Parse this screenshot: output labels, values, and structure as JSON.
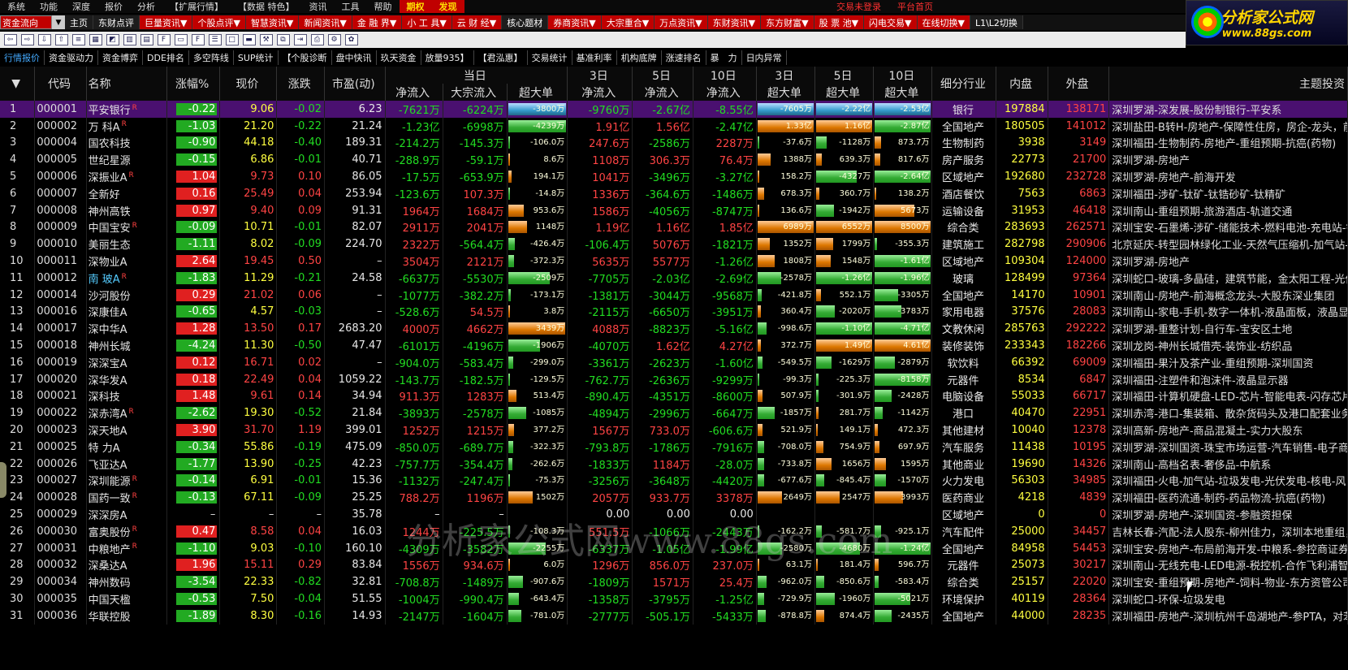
{
  "menu": {
    "items": [
      "系统",
      "功能",
      "深度",
      "报价",
      "分析",
      "【扩展行情】",
      "【数据 特色】",
      "资讯",
      "工具",
      "帮助"
    ],
    "highlights": [
      "期权",
      "发现"
    ],
    "status1": "交易未登录",
    "status2": "平台首页"
  },
  "logo": {
    "text": "分析家公式网",
    "url": "www.88gs.com"
  },
  "nav": {
    "select": "资金流向",
    "items": [
      "主页",
      "东财点评",
      "巨量资讯▼",
      "个股点评▼",
      "智慧资讯▼",
      "新闻资讯▼",
      "金 融 界▼",
      "小 工 具▼",
      "云 财 经▼",
      "核心题材",
      "券商资讯▼",
      "大宗重合▼",
      "万点资讯▼",
      "东财资讯▼",
      "东方财富▼",
      "股 票 池▼",
      "闪电交易▼",
      "在线切换▼",
      "L1\\L2切换"
    ],
    "red_items": [
      2,
      3,
      4,
      5,
      6,
      7,
      8,
      10,
      11,
      12,
      13,
      14,
      15,
      16,
      17
    ]
  },
  "icons": [
    "back-icon",
    "forward-icon",
    "down-icon",
    "up-icon",
    "list-icon",
    "grid-icon",
    "chart-icon",
    "candle-icon",
    "table-icon",
    "f10-icon",
    "doc-icon",
    "f2-icon",
    "mark-icon",
    "square-icon",
    "folder-icon",
    "tool-icon",
    "copy-icon",
    "export-icon",
    "print-icon",
    "calc-icon",
    "settings-icon"
  ],
  "tabs": [
    "行情报价",
    "资金驱动力",
    "资金博弈",
    "DDE排名",
    "多空阵线",
    "SUP统计",
    "【个股诊断",
    "盘中快讯",
    "玖天资金",
    "放量935】",
    "【君泓惠】",
    "交易统计",
    "基准利率",
    "机构底牌",
    "涨速排名",
    "暴　力",
    "日内异常"
  ],
  "headers": {
    "top": {
      "today": "当日",
      "d3": "3日",
      "d5": "5日",
      "d10": "10日",
      "c3": "3日",
      "c5": "5日",
      "c10": "10日"
    },
    "cols": [
      "代码",
      "名称",
      "涨幅%",
      "现价",
      "涨跌",
      "市盈(动)",
      "净流入",
      "大宗流入",
      "超大单",
      "净流入",
      "净流入",
      "净流入",
      "超大单",
      "超大单",
      "超大单",
      "细分行业",
      "内盘",
      "外盘",
      "主题投资"
    ]
  },
  "rows": [
    [
      "1",
      "000001",
      "平安银行",
      "R",
      "-0.22",
      "9.06",
      "-0.02",
      "6.23",
      "-7621万",
      "-6224万",
      "-3800万",
      "-9760万",
      "-2.67亿",
      "-8.55亿",
      "-7605万",
      "-2.22亿",
      "-2.53亿",
      "银行",
      "197884",
      "138171",
      "深圳罗湖-深发展-股份制银行-平安系"
    ],
    [
      "2",
      "000002",
      "万 科A",
      "R",
      "-1.03",
      "21.20",
      "-0.22",
      "21.24",
      "-1.23亿",
      "-6998万",
      "-4239万",
      "1.91亿",
      "1.56亿",
      "-2.47亿",
      "1.33亿",
      "1.16亿",
      "-2.87亿",
      "全国地产",
      "180505",
      "141012",
      "深圳盐田-B转H-房地产-保障性住房，房企-龙头，前海"
    ],
    [
      "3",
      "000004",
      "国农科技",
      "",
      "-0.90",
      "44.18",
      "-0.40",
      "189.31",
      "-214.2万",
      "-145.3万",
      "-106.0万",
      "247.6万",
      "-2586万",
      "2287万",
      "-37.6万",
      "-1128万",
      "873.7万",
      "生物制药",
      "3938",
      "3149",
      "深圳福田-生物制药-房地产-重组预期-抗癌(药物)"
    ],
    [
      "4",
      "000005",
      "世纪星源",
      "",
      "-0.15",
      "6.86",
      "-0.01",
      "40.71",
      "-288.9万",
      "-59.1万",
      "8.6万",
      "1108万",
      "306.3万",
      "76.4万",
      "1388万",
      "639.3万",
      "817.6万",
      "房产服务",
      "22773",
      "21700",
      "深圳罗湖-房地产"
    ],
    [
      "5",
      "000006",
      "深振业A",
      "R",
      "1.04",
      "9.73",
      "0.10",
      "86.05",
      "-17.5万",
      "-653.9万",
      "194.1万",
      "1041万",
      "-3496万",
      "-3.27亿",
      "158.2万",
      "-4327万",
      "-2.64亿",
      "区域地产",
      "192680",
      "232728",
      "深圳罗湖-房地产-前海开发"
    ],
    [
      "6",
      "000007",
      "全新好",
      "",
      "0.16",
      "25.49",
      "0.04",
      "253.94",
      "-123.6万",
      "107.3万",
      "-14.8万",
      "1336万",
      "-364.6万",
      "-1486万",
      "678.3万",
      "360.7万",
      "138.2万",
      "酒店餐饮",
      "7563",
      "6863",
      "深圳福田-涉矿-钛矿-钛锆砂矿-钛精矿"
    ],
    [
      "7",
      "000008",
      "神州高铁",
      "",
      "0.97",
      "9.40",
      "0.09",
      "91.31",
      "1964万",
      "1684万",
      "953.6万",
      "1586万",
      "-4056万",
      "-8747万",
      "136.6万",
      "-1942万",
      "5673万",
      "运输设备",
      "31953",
      "46418",
      "深圳南山-重组预期-旅游酒店-轨道交通"
    ],
    [
      "8",
      "000009",
      "中国宝安",
      "R",
      "-0.09",
      "10.71",
      "-0.01",
      "82.07",
      "2911万",
      "2041万",
      "1148万",
      "1.19亿",
      "1.16亿",
      "1.85亿",
      "6989万",
      "6552万",
      "8500万",
      "综合类",
      "283693",
      "262571",
      "深圳宝安-石墨烯-涉矿-储能技术-燃料电池-充电站-锂电"
    ],
    [
      "9",
      "000010",
      "美丽生态",
      "",
      "-1.11",
      "8.02",
      "-0.09",
      "224.70",
      "2322万",
      "-564.4万",
      "-426.4万",
      "-106.4万",
      "5076万",
      "-1821万",
      "1352万",
      "1799万",
      "-355.3万",
      "建筑施工",
      "282798",
      "290906",
      "北京延庆-转型园林绿化工业-天然气压缩机-加气站-原"
    ],
    [
      "10",
      "000011",
      "深物业A",
      "",
      "2.64",
      "19.45",
      "0.50",
      "–",
      "3504万",
      "2121万",
      "-372.3万",
      "5635万",
      "5577万",
      "-1.26亿",
      "1808万",
      "1548万",
      "-1.61亿",
      "区域地产",
      "109304",
      "124000",
      "深圳罗湖-房地产"
    ],
    [
      "11",
      "000012",
      "南 玻A",
      "R",
      "-1.83",
      "11.29",
      "-0.21",
      "24.58",
      "-6637万",
      "-5530万",
      "-2509万",
      "-7705万",
      "-2.03亿",
      "-2.69亿",
      "-2578万",
      "-1.26亿",
      "-1.96亿",
      "玻璃",
      "128499",
      "97364",
      "深圳蛇口-玻璃-多晶硅，建筑节能，金太阳工程-光伏"
    ],
    [
      "12",
      "000014",
      "沙河股份",
      "",
      "0.29",
      "21.02",
      "0.06",
      "–",
      "-1077万",
      "-382.2万",
      "-173.1万",
      "-1381万",
      "-3044万",
      "-9568万",
      "-421.8万",
      "552.1万",
      "-3305万",
      "全国地产",
      "14170",
      "10901",
      "深圳南山-房地产-前海概念龙头-大股东深业集团"
    ],
    [
      "13",
      "000016",
      "深康佳A",
      "",
      "-0.65",
      "4.57",
      "-0.03",
      "–",
      "-528.6万",
      "54.5万",
      "3.8万",
      "-2115万",
      "-6650万",
      "-3951万",
      "360.4万",
      "-2020万",
      "-3783万",
      "家用电器",
      "37576",
      "28083",
      "深圳南山-家电-手机-数字一体机-液晶面板，液晶显示"
    ],
    [
      "14",
      "000017",
      "深中华A",
      "",
      "1.28",
      "13.50",
      "0.17",
      "2683.20",
      "4000万",
      "4662万",
      "3439万",
      "4088万",
      "-8823万",
      "-5.16亿",
      "-998.6万",
      "-1.10亿",
      "-4.71亿",
      "文教休闲",
      "285763",
      "292222",
      "深圳罗湖-重整计划-自行车-宝安区土地"
    ],
    [
      "15",
      "000018",
      "神州长城",
      "",
      "-4.24",
      "11.30",
      "-0.50",
      "47.47",
      "-6101万",
      "-4196万",
      "-1906万",
      "-4070万",
      "1.62亿",
      "4.27亿",
      "372.7万",
      "1.49亿",
      "4.61亿",
      "装修装饰",
      "233343",
      "182266",
      "深圳龙岗-神州长城借壳-装饰业-纺织品"
    ],
    [
      "16",
      "000019",
      "深深宝A",
      "",
      "0.12",
      "16.71",
      "0.02",
      "–",
      "-904.0万",
      "-583.4万",
      "-299.0万",
      "-3361万",
      "-2623万",
      "-1.60亿",
      "-549.5万",
      "-1629万",
      "-2879万",
      "软饮料",
      "66392",
      "69009",
      "深圳福田-果汁及茶产业-重组预期-深圳国资"
    ],
    [
      "17",
      "000020",
      "深华发A",
      "",
      "0.18",
      "22.49",
      "0.04",
      "1059.22",
      "-143.7万",
      "-182.5万",
      "-129.5万",
      "-762.7万",
      "-2636万",
      "-9299万",
      "-99.3万",
      "-225.3万",
      "-8158万",
      "元器件",
      "8534",
      "6847",
      "深圳福田-注塑件和泡沫件-液晶显示器"
    ],
    [
      "18",
      "000021",
      "深科技",
      "",
      "1.48",
      "9.61",
      "0.14",
      "34.94",
      "911.3万",
      "1283万",
      "513.4万",
      "-890.4万",
      "-4351万",
      "-8600万",
      "507.9万",
      "-301.9万",
      "-2428万",
      "电脑设备",
      "55033",
      "66717",
      "深圳福田-计算机硬盘-LED-芯片-智能电表-闪存芯片-积"
    ],
    [
      "19",
      "000022",
      "深赤湾A",
      "R",
      "-2.62",
      "19.30",
      "-0.52",
      "21.84",
      "-3893万",
      "-2578万",
      "-1085万",
      "-4894万",
      "-2996万",
      "-6647万",
      "-1857万",
      "281.7万",
      "-1142万",
      "港口",
      "40470",
      "22951",
      "深圳赤湾-港口-集装箱、散杂货码头及港口配套业务-"
    ],
    [
      "20",
      "000023",
      "深天地A",
      "",
      "3.90",
      "31.70",
      "1.19",
      "399.01",
      "1252万",
      "1215万",
      "377.2万",
      "1567万",
      "733.0万",
      "-606.6万",
      "521.9万",
      "149.1万",
      "472.3万",
      "其他建材",
      "10040",
      "12378",
      "深圳高新-房地产-商品混凝土-实力大股东"
    ],
    [
      "21",
      "000025",
      "特 力A",
      "",
      "-0.34",
      "55.86",
      "-0.19",
      "475.09",
      "-850.0万",
      "-689.7万",
      "-322.3万",
      "-793.8万",
      "-1786万",
      "-7916万",
      "-708.0万",
      "754.9万",
      "697.9万",
      "汽车服务",
      "11438",
      "10195",
      "深圳罗湖-深圳国资-珠宝市场运营-汽车销售-电子商务"
    ],
    [
      "22",
      "000026",
      "飞亚达A",
      "",
      "-1.77",
      "13.90",
      "-0.25",
      "42.23",
      "-757.7万",
      "-354.4万",
      "-262.6万",
      "-1833万",
      "1184万",
      "-28.0万",
      "-733.8万",
      "1656万",
      "1595万",
      "其他商业",
      "19690",
      "14326",
      "深圳南山-高档名表-奢侈品-中航系"
    ],
    [
      "23",
      "000027",
      "深圳能源",
      "R",
      "-0.14",
      "6.91",
      "-0.01",
      "15.36",
      "-1132万",
      "-247.4万",
      "-75.3万",
      "-3256万",
      "-3648万",
      "-4420万",
      "-677.6万",
      "-845.4万",
      "-1570万",
      "火力发电",
      "56303",
      "34985",
      "深圳福田-火电-加气站-垃圾发电-光伏发电-核电-风电-"
    ],
    [
      "24",
      "000028",
      "国药一致",
      "R",
      "-0.13",
      "67.11",
      "-0.09",
      "25.25",
      "788.2万",
      "1196万",
      "1502万",
      "2057万",
      "933.7万",
      "3378万",
      "2649万",
      "2547万",
      "3993万",
      "医药商业",
      "4218",
      "4839",
      "深圳福田-医药流通-制药-药品物流-抗癌(药物)"
    ],
    [
      "25",
      "000029",
      "深深房A",
      "",
      "–",
      "–",
      "–",
      "35.78",
      "–",
      "–",
      "",
      "0.00",
      "0.00",
      "0.00",
      "",
      "",
      "",
      "区域地产",
      "0",
      "0",
      "深圳罗湖-房地产-深圳国资-参融资担保"
    ],
    [
      "26",
      "000030",
      "富奥股份",
      "R",
      "0.47",
      "8.58",
      "0.04",
      "16.03",
      "1244万",
      "-225.5万",
      "-108.3万",
      "551.5万",
      "-1066万",
      "-2443万",
      "-162.2万",
      "-581.7万",
      "-925.1万",
      "汽车配件",
      "25000",
      "34457",
      "吉林长春-汽配-法人股东-柳州佳力，深圳本地重组，"
    ],
    [
      "27",
      "000031",
      "中粮地产",
      "R",
      "-1.10",
      "9.03",
      "-0.10",
      "160.10",
      "-4309万",
      "-3582万",
      "-2255万",
      "-6337万",
      "-1.05亿",
      "-1.99亿",
      "-2580万",
      "-4680万",
      "-1.24亿",
      "全国地产",
      "84958",
      "54453",
      "深圳宝安-房地产-布局前海开发-中粮系-参控商证券、"
    ],
    [
      "28",
      "000032",
      "深桑达A",
      "",
      "1.96",
      "15.11",
      "0.29",
      "83.84",
      "1556万",
      "934.6万",
      "6.0万",
      "1296万",
      "856.0万",
      "237.0万",
      "63.1万",
      "181.4万",
      "596.7万",
      "元器件",
      "25073",
      "30217",
      "深圳南山-无线充电-LED电源-税控机-合作飞利浦智慧"
    ],
    [
      "29",
      "000034",
      "神州数码",
      "",
      "-3.54",
      "22.33",
      "-0.82",
      "32.81",
      "-708.8万",
      "-1489万",
      "-907.6万",
      "-1809万",
      "1571万",
      "25.4万",
      "-962.0万",
      "-850.6万",
      "-583.4万",
      "综合类",
      "25157",
      "22020",
      "深圳宝安-重组预期-房地产-饲料-物业-东方资管公司持"
    ],
    [
      "30",
      "000035",
      "中国天楹",
      "",
      "-0.53",
      "7.50",
      "-0.04",
      "51.55",
      "-1004万",
      "-990.4万",
      "-643.4万",
      "-1358万",
      "-3795万",
      "-1.25亿",
      "-729.9万",
      "-1960万",
      "-5021万",
      "环境保护",
      "40119",
      "28364",
      "深圳蛇口-环保-垃圾发电"
    ],
    [
      "31",
      "000036",
      "华联控股",
      "",
      "-1.89",
      "8.30",
      "-0.16",
      "14.93",
      "-2147万",
      "-1604万",
      "-781.0万",
      "-2777万",
      "-505.1万",
      "-5433万",
      "-878.8万",
      "874.4万",
      "-2435万",
      "全国地产",
      "44000",
      "28235",
      "深圳福田-房地产-深圳杭州千岛湖地产-参PTA，对苯二"
    ]
  ],
  "bar_colors": {
    "neg": "#33aa33",
    "pos": "#dd7700",
    "sel": "#3399cc"
  },
  "watermark": "分析家公式网www.88gs.com"
}
